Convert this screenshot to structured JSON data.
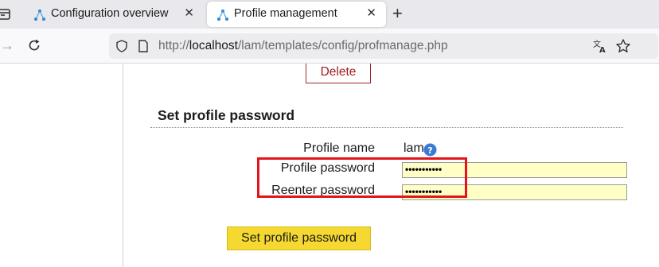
{
  "browser": {
    "tabs": [
      {
        "title": "Configuration overview",
        "active": false
      },
      {
        "title": "Profile management",
        "active": true
      }
    ],
    "url_prefix": "http://",
    "url_host": "localhost",
    "url_path": "/lam/templates/config/profmanage.php"
  },
  "page": {
    "delete_label": "Delete",
    "section_title": "Set profile password",
    "profile_name_label": "Profile name",
    "profile_name_value": "lam",
    "profile_password_label": "Profile password",
    "reenter_password_label": "Reenter password",
    "password_mask": "•••••••••••",
    "reenter_mask": "•••••••••••",
    "submit_label": "Set profile password"
  },
  "colors": {
    "highlight": "#e3141a",
    "submit_button": "#f5d830",
    "input_background": "#ffffc5",
    "delete_text": "#a31e1e",
    "help_icon": "#3a7bd5"
  }
}
